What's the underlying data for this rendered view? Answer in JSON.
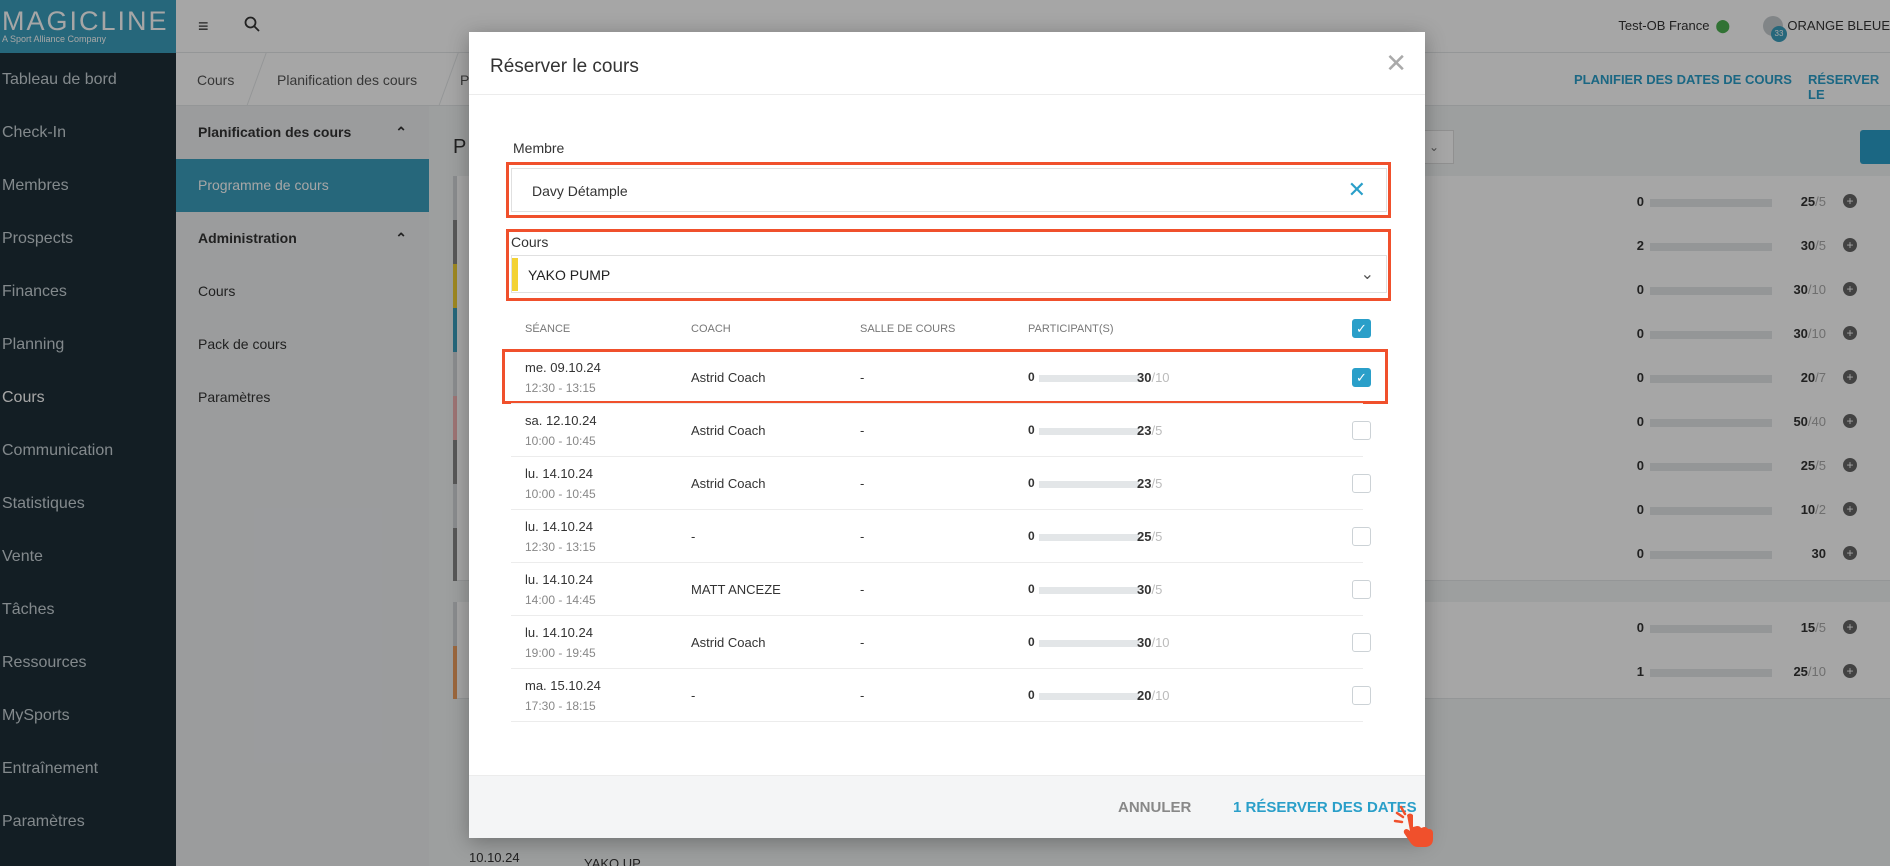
{
  "sidebar": {
    "logo": "MAGICLINE",
    "logo_sub": "A Sport Alliance Company",
    "items": [
      {
        "label": "Tableau de bord"
      },
      {
        "label": "Check-In"
      },
      {
        "label": "Membres"
      },
      {
        "label": "Prospects"
      },
      {
        "label": "Finances"
      },
      {
        "label": "Planning"
      },
      {
        "label": "Cours"
      },
      {
        "label": "Communication"
      },
      {
        "label": "Statistiques"
      },
      {
        "label": "Vente"
      },
      {
        "label": "Tâches"
      },
      {
        "label": "Ressources"
      },
      {
        "label": "MySports"
      },
      {
        "label": "Entraînement"
      },
      {
        "label": "Paramètres"
      }
    ],
    "active": "Cours"
  },
  "topbar": {
    "studio": "Test-OB France",
    "org": "ORANGE BLEUE",
    "badge": "33"
  },
  "breadcrumb": {
    "items": [
      "Cours",
      "Planification des cours",
      "P"
    ],
    "actions": [
      "PLANIFIER DES DATES DE COURS",
      "RÉSERVER LE"
    ]
  },
  "subnav": {
    "group1": "Planification des cours",
    "group1_items": [
      "Programme de cours"
    ],
    "group2": "Administration",
    "group2_items": [
      "Cours",
      "Pack de cours",
      "Paramètres"
    ]
  },
  "background": {
    "title": "P",
    "rows": [
      {
        "left": "0",
        "fill": 0,
        "cap": "25",
        "den": "/5",
        "strip": "#d5d8da"
      },
      {
        "left": "2",
        "fill": 0.05,
        "cap": "30",
        "den": "/5",
        "strip": "#888"
      },
      {
        "left": "0",
        "fill": 0,
        "cap": "30",
        "den": "/10",
        "strip": "#f3d233"
      },
      {
        "left": "0",
        "fill": 0,
        "cap": "30",
        "den": "/10",
        "strip": "#3b9fbd"
      },
      {
        "left": "0",
        "fill": 0,
        "cap": "20",
        "den": "/7",
        "strip": "#d5d8da"
      },
      {
        "left": "0",
        "fill": 0,
        "cap": "50",
        "den": "/40",
        "strip": "#f3b4b4"
      },
      {
        "left": "0",
        "fill": 0,
        "cap": "25",
        "den": "/5",
        "strip": "#888"
      },
      {
        "left": "0",
        "fill": 0,
        "cap": "10",
        "den": "/2",
        "strip": "#d5d8da"
      },
      {
        "left": "0",
        "fill": 0,
        "cap": "30",
        "den": "",
        "strip": "#888"
      },
      {
        "left": "0",
        "fill": 0,
        "cap": "15",
        "den": "/5",
        "strip": "#d5d8da"
      },
      {
        "left": "1",
        "fill": 0.03,
        "cap": "25",
        "den": "/10",
        "strip": "#f0a060"
      }
    ],
    "bottom_date": "10.10.24",
    "bottom_text": "YAKO UP"
  },
  "modal": {
    "title": "Réserver le cours",
    "member_label": "Membre",
    "member_value": "Davy Détample",
    "course_label": "Cours",
    "course_value": "YAKO PUMP",
    "columns": [
      "SÉANCE",
      "COACH",
      "SALLE DE COURS",
      "PARTICIPANT(S)"
    ],
    "sessions": [
      {
        "date": "me. 09.10.24",
        "time": "12:30 - 13:15",
        "coach": "Astrid Coach",
        "room": "-",
        "booked": "0",
        "cap": "30",
        "den": "/10",
        "checked": true
      },
      {
        "date": "sa. 12.10.24",
        "time": "10:00 - 10:45",
        "coach": "Astrid Coach",
        "room": "-",
        "booked": "0",
        "cap": "23",
        "den": "/5",
        "checked": false
      },
      {
        "date": "lu. 14.10.24",
        "time": "10:00 - 10:45",
        "coach": "Astrid Coach",
        "room": "-",
        "booked": "0",
        "cap": "23",
        "den": "/5",
        "checked": false
      },
      {
        "date": "lu. 14.10.24",
        "time": "12:30 - 13:15",
        "coach": "-",
        "room": "-",
        "booked": "0",
        "cap": "25",
        "den": "/5",
        "checked": false
      },
      {
        "date": "lu. 14.10.24",
        "time": "14:00 - 14:45",
        "coach": "MATT ANCEZE",
        "room": "-",
        "booked": "0",
        "cap": "30",
        "den": "/5",
        "checked": false
      },
      {
        "date": "lu. 14.10.24",
        "time": "19:00 - 19:45",
        "coach": "Astrid Coach",
        "room": "-",
        "booked": "0",
        "cap": "30",
        "den": "/10",
        "checked": false
      },
      {
        "date": "ma. 15.10.24",
        "time": "17:30 - 18:15",
        "coach": "-",
        "room": "-",
        "booked": "0",
        "cap": "20",
        "den": "/10",
        "checked": false
      }
    ],
    "cancel": "ANNULER",
    "submit": "1 RÉSERVER DES DATES"
  },
  "colors": {
    "accent": "#2a9fc9",
    "highlight": "#f0502c",
    "sidebar": "#1e2f38"
  }
}
